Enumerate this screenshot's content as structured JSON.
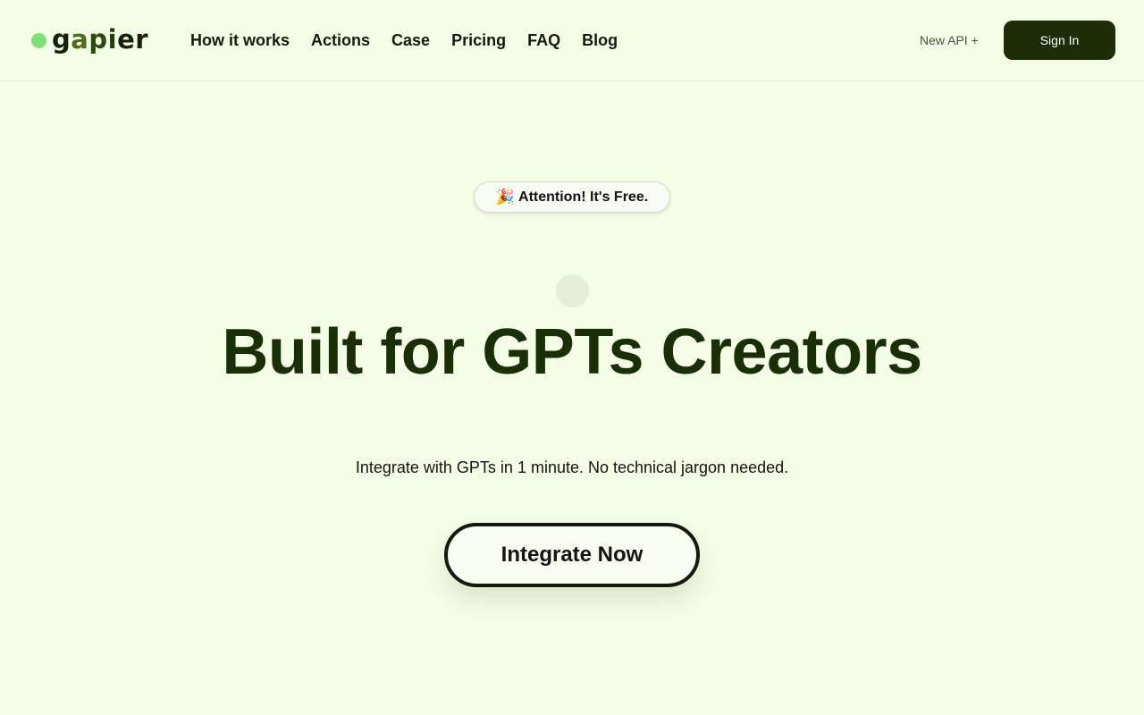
{
  "logo": {
    "parts": [
      "g",
      "a",
      "p",
      "i",
      "er"
    ]
  },
  "nav": {
    "items": [
      "How it works",
      "Actions",
      "Case",
      "Pricing",
      "FAQ",
      "Blog"
    ]
  },
  "header": {
    "new_api_label": "New API +",
    "signin_label": "Sign In"
  },
  "hero": {
    "badge_icon": "🎉",
    "badge_text": "Attention! It's Free.",
    "title": "Built for GPTs Creators",
    "subtitle": "Integrate with GPTs in 1 minute. No technical jargon needed.",
    "cta_label": "Integrate Now"
  },
  "colors": {
    "background": "#f4fde6",
    "brand_dark": "#1c2d08",
    "logo_dot": "#7fe07a"
  }
}
